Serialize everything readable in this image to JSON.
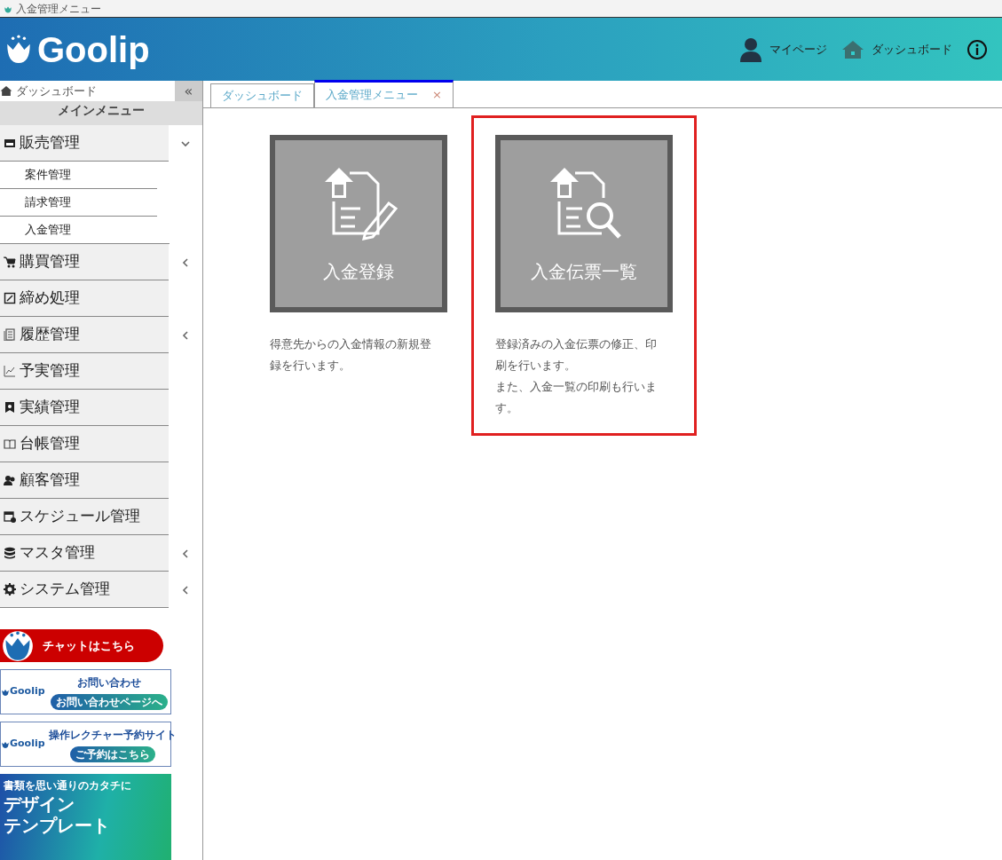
{
  "window": {
    "title": "入金管理メニュー"
  },
  "header": {
    "logo": "Goolip",
    "links": [
      {
        "kind": "user",
        "label": "マイページ"
      },
      {
        "kind": "home",
        "label": "ダッシュボード"
      },
      {
        "kind": "info"
      }
    ]
  },
  "sidebar": {
    "dashboard": "ダッシュボード",
    "collapse": "«",
    "heading": "メインメニュー",
    "items": [
      {
        "label": "販売管理",
        "kind": "group",
        "expanded": true,
        "children": [
          {
            "label": "案件管理"
          },
          {
            "label": "請求管理"
          },
          {
            "label": "入金管理"
          }
        ]
      },
      {
        "label": "購買管理",
        "kind": "group",
        "expanded": false
      },
      {
        "label": "締め処理",
        "kind": "link"
      },
      {
        "label": "履歴管理",
        "kind": "group",
        "expanded": false
      },
      {
        "label": "予実管理",
        "kind": "link"
      },
      {
        "label": "実績管理",
        "kind": "link"
      },
      {
        "label": "台帳管理",
        "kind": "link"
      },
      {
        "label": "顧客管理",
        "kind": "link"
      },
      {
        "label": "スケジュール管理",
        "kind": "link"
      },
      {
        "label": "マスタ管理",
        "kind": "group",
        "expanded": false
      },
      {
        "label": "システム管理",
        "kind": "group",
        "expanded": false
      }
    ],
    "banners": [
      {
        "kind": "chat",
        "text": "チャットはこちら"
      },
      {
        "kind": "contact",
        "logo": "Goolip",
        "title": "お問い合わせ",
        "button": "お問い合わせページへ"
      },
      {
        "kind": "contact",
        "logo": "Goolip",
        "title": "操作レクチャー予約サイト",
        "button": "ご予約はこちら"
      },
      {
        "kind": "promo",
        "tagline": "書類を思い通りのカタチに",
        "headline": [
          "デザイン",
          "テンプレート"
        ]
      }
    ]
  },
  "tabs": [
    {
      "label": "ダッシュボード",
      "selected": false
    },
    {
      "label": "入金管理メニュー",
      "selected": true,
      "close": "×"
    }
  ],
  "cards": [
    {
      "kind": "register",
      "title": "入金登録",
      "description": [
        "得意先からの入金情報の新規登録を行います。"
      ],
      "highlighted": false
    },
    {
      "kind": "list",
      "title": "入金伝票一覧",
      "description": [
        "登録済みの入金伝票の修正、印刷を行います。",
        "また、入金一覧の印刷も行います。"
      ],
      "highlighted": true
    }
  ]
}
